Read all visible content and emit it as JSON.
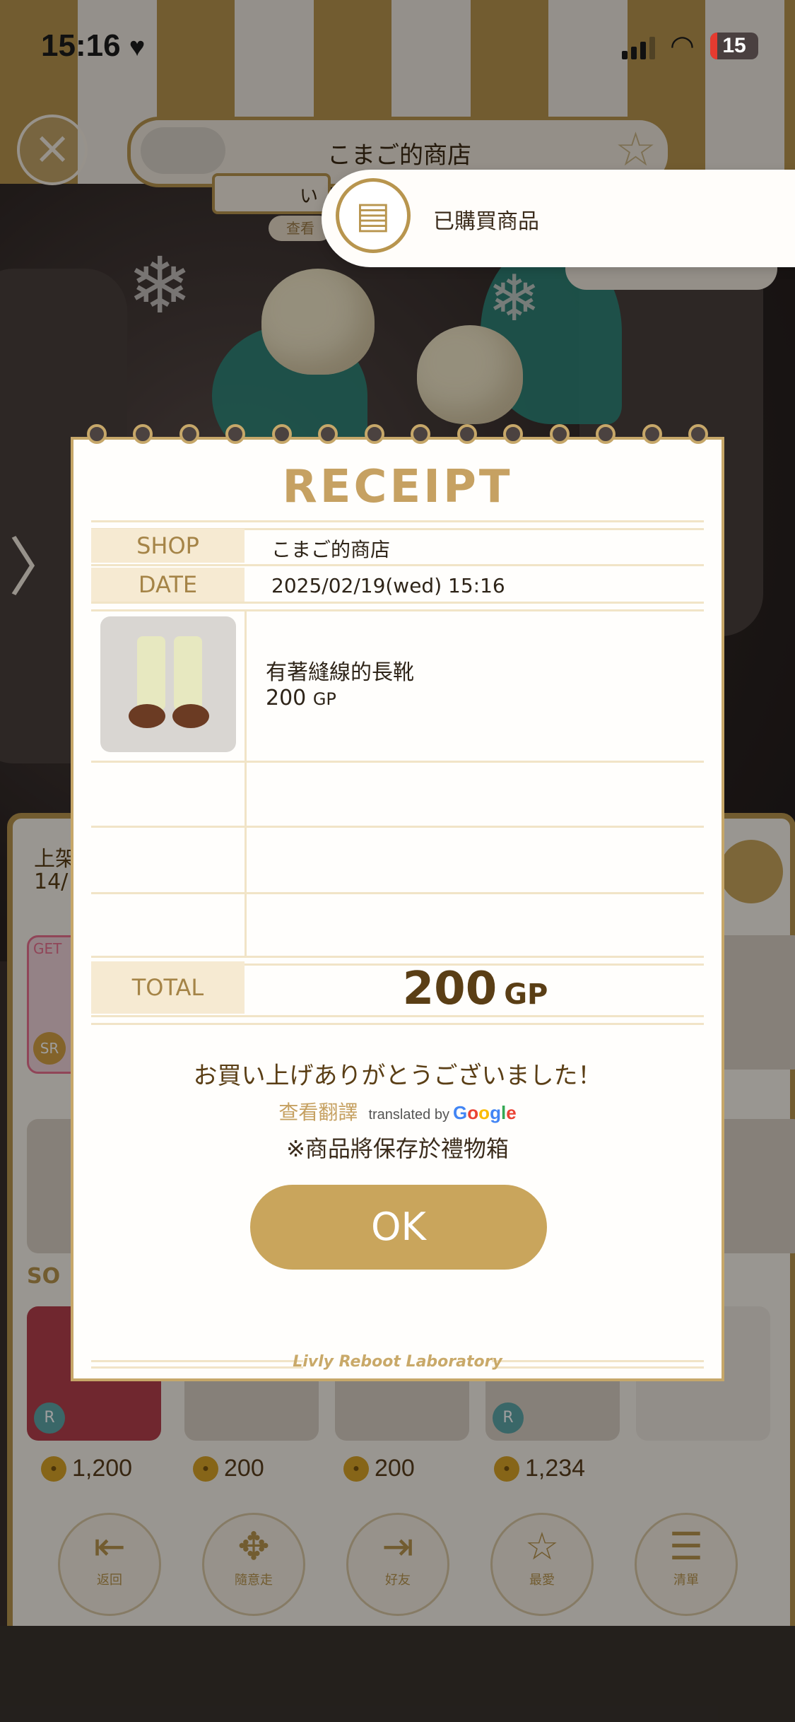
{
  "status_bar": {
    "time": "15:16",
    "battery": "15",
    "battery_level": 0.15
  },
  "header": {
    "shop_name": "こまご的商店",
    "sub_tab": "い",
    "view_link": "查看"
  },
  "toast": {
    "text": "已購買商品"
  },
  "background_panel": {
    "listing_label": "上架",
    "listing_count": "14/",
    "get_badge": "GET",
    "sr_badge": "SR",
    "section_label": "SO",
    "r_badge": "R",
    "prices": [
      "1,200",
      "200",
      "200",
      "1,234"
    ],
    "nav": [
      "返回",
      "隨意走",
      "好友",
      "最愛",
      "清單"
    ]
  },
  "receipt": {
    "title": "RECEIPT",
    "shop_label": "SHOP",
    "shop_value": "こまご的商店",
    "date_label": "DATE",
    "date_value": "2025/02/19(wed) 15:16",
    "item": {
      "name": "有著縫線的長靴",
      "price": "200",
      "unit": "GP"
    },
    "total_label": "TOTAL",
    "total_value": "200",
    "total_unit": "GP",
    "thanks": "お買い上げありがとうございました！",
    "translate_link": "查看翻譯",
    "translated_by": "translated by",
    "google": "Google",
    "notice": "※商品將保存於禮物箱",
    "ok_label": "OK",
    "footer": "Livly Reboot Laboratory"
  }
}
